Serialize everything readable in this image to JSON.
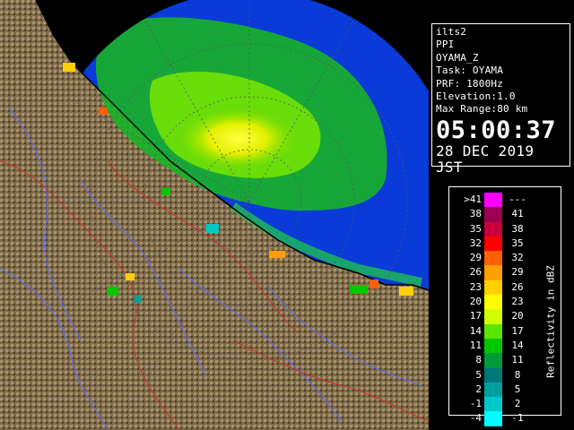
{
  "info": {
    "radar_id": "ilts2",
    "product": "PPI",
    "field": "OYAMA_Z",
    "task": "Task: OYAMA",
    "prf": "PRF: 1800Hz",
    "elevation": "Elevation:1.0",
    "max_range": "Max Range:80 km",
    "time": "05:00:37",
    "date": "28 DEC 2019 JST"
  },
  "legend": {
    "unit_label": "Reflectivity in dBZ",
    "rows": [
      {
        "lo": ">41",
        "hi": "---",
        "color": "#ff00ff"
      },
      {
        "lo": "38",
        "hi": "41",
        "color": "#9c0050"
      },
      {
        "lo": "35",
        "hi": "38",
        "color": "#c8003c"
      },
      {
        "lo": "32",
        "hi": "35",
        "color": "#ff0000"
      },
      {
        "lo": "29",
        "hi": "32",
        "color": "#ff6000"
      },
      {
        "lo": "26",
        "hi": "29",
        "color": "#ffa000"
      },
      {
        "lo": "23",
        "hi": "26",
        "color": "#ffd000"
      },
      {
        "lo": "20",
        "hi": "23",
        "color": "#ffff00"
      },
      {
        "lo": "17",
        "hi": "20",
        "color": "#d2ff00"
      },
      {
        "lo": "14",
        "hi": "17",
        "color": "#5ae600"
      },
      {
        "lo": "11",
        "hi": "14",
        "color": "#00c800"
      },
      {
        "lo": "8",
        "hi": "11",
        "color": "#009a3c"
      },
      {
        "lo": "5",
        "hi": "8",
        "color": "#007878"
      },
      {
        "lo": "2",
        "hi": "5",
        "color": "#00a0a0"
      },
      {
        "lo": "-1",
        "hi": "2",
        "color": "#00c8c8"
      },
      {
        "lo": "-4",
        "hi": "-1",
        "color": "#00ffff"
      }
    ]
  },
  "colors": {
    "sea_range": "#0a3ad8",
    "sea_outside": "#000000",
    "land": "#7d6a4a",
    "rivers": "#5a6cff",
    "boundaries": "#d03030",
    "echo_core": "#ffff00",
    "echo_main": "#00c800"
  }
}
